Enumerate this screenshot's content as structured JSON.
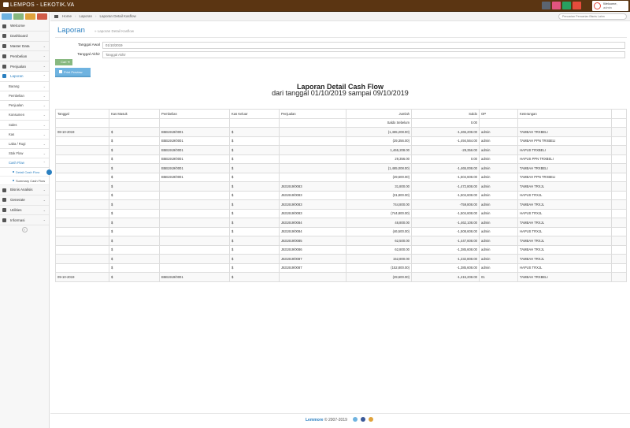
{
  "app": {
    "title": "LEMPOS - LEKOTIK.VA"
  },
  "topbar": {
    "icons": [
      {
        "name": "monitor-icon",
        "color": "#5b6470",
        "badge": ""
      },
      {
        "name": "user-icon",
        "color": "#e0547e",
        "badge": ""
      },
      {
        "name": "mail-icon",
        "color": "#27a060",
        "badge": ""
      },
      {
        "name": "cart-icon",
        "color": "#e74c3c",
        "badge": ""
      }
    ],
    "welcome": "Welcome,",
    "user": "admin"
  },
  "sidebar": {
    "shortcut_colors": [
      "#6fb3e0",
      "#87b87f",
      "#e0a33c",
      "#d15b47"
    ],
    "items": [
      {
        "label": "Welcome",
        "icon": "home-icon"
      },
      {
        "label": "Dashboard",
        "icon": "dashboard-icon"
      },
      {
        "label": "Master Data",
        "icon": "desktop-icon",
        "chevron": "⌄"
      },
      {
        "label": "Pembelian",
        "icon": "list-icon",
        "chevron": "⌄"
      },
      {
        "label": "Penjualan",
        "icon": "edit-icon",
        "chevron": "⌄"
      },
      {
        "label": "Laporan",
        "icon": "chart-icon",
        "chevron": "⌃"
      }
    ],
    "laporan_sub": [
      {
        "label": "Barang",
        "chevron": "⌄"
      },
      {
        "label": "Pembelian",
        "chevron": "⌄"
      },
      {
        "label": "Penjualan",
        "chevron": "⌄"
      },
      {
        "label": "Konsumen",
        "chevron": "⌄"
      },
      {
        "label": "Sales",
        "chevron": "⌄"
      },
      {
        "label": "Kas",
        "chevron": "⌄"
      },
      {
        "label": "Laba / Rugi",
        "chevron": "⌄"
      },
      {
        "label": "Stok Flow",
        "chevron": "⌄"
      },
      {
        "label": "Cash Flow",
        "chevron": "⌃"
      }
    ],
    "cashflow_sub": [
      "Detail Cash Flow",
      "Summary Cash Flow"
    ],
    "items_after": [
      {
        "label": "Bisnis Analisis",
        "icon": "trend-icon",
        "chevron": "⌄"
      },
      {
        "label": "Generate",
        "icon": "gears-icon",
        "chevron": "⌄"
      },
      {
        "label": "Utilities",
        "icon": "tool-icon",
        "chevron": "⌄"
      },
      {
        "label": "Informasi",
        "icon": "info-icon",
        "chevron": "⌄"
      }
    ],
    "collapse": "«"
  },
  "breadcrumb": {
    "home": "Home",
    "laporan": "Laporan",
    "current": "Laporan Detail Kasflow"
  },
  "search": {
    "placeholder": "Pencarian Pencarian Bisnis Lainn"
  },
  "header": {
    "title": "Laporan",
    "subtitle": "» Laporan Detail Kasflow"
  },
  "form": {
    "tanggal_awal_label": "Tanggal Awal",
    "tanggal_awal_value": "01/10/2019",
    "tanggal_akhir_label": "Tanggal Akhir",
    "tanggal_akhir_placeholder": "Tanggal Akhir",
    "cari_label": "Cari",
    "print_label": "Print Preview"
  },
  "report": {
    "title": "Laporan Detail Cash Flow",
    "subtitle": "dari tanggal 01/10/2019 sampai 09/10/2019",
    "columns": [
      "Tanggal",
      "Kas Masuk",
      "Pembelian",
      "Kas Keluar",
      "Penjualan",
      "Jumlah",
      "Saldo",
      "OP",
      "Keterangan",
      ""
    ],
    "saldo_sebelum_label": "Saldo Sebelum",
    "saldo_sebelum_value": "0.00",
    "rows": [
      [
        "08-10-2019",
        "$",
        "B5B1919/0001",
        "$",
        "",
        "(1,465,208.00)",
        "-1,465,208.00",
        "admin",
        "TAMBAH TRXBELI",
        ""
      ],
      [
        "",
        "$",
        "B5B1919/0001",
        "$",
        "",
        "(29,356.00)",
        "-1,494,564.00",
        "admin",
        "TAMBAH PPN TRXBELI",
        ""
      ],
      [
        "",
        "$",
        "B5B1919/0001",
        "$",
        "",
        "1,465,208.00",
        "-29,356.00",
        "admin",
        "HAPUS TRXBELI",
        ""
      ],
      [
        "",
        "$",
        "B5B1919/0001",
        "$",
        "",
        "29,356.00",
        "0.00",
        "admin",
        "HAPUS PPN TRXBELI",
        ""
      ],
      [
        "",
        "$",
        "B5B1919/0001",
        "$",
        "",
        "(1,465,008.00)",
        "-1,465,008.00",
        "admin",
        "TAMBAH TRXBELI",
        ""
      ],
      [
        "",
        "$",
        "B5B1919/0001",
        "$",
        "",
        "(29,600.00)",
        "-1,504,608.00",
        "admin",
        "TAMBAH PPN TRXBELI",
        ""
      ],
      [
        "",
        "$",
        "",
        "$",
        "J631919/0083",
        "31,800.00",
        "-1,472,808.00",
        "admin",
        "TAMBAH TRXJL",
        ""
      ],
      [
        "",
        "$",
        "",
        "$",
        "J631919/0083",
        "(31,800.00)",
        "-1,504,608.00",
        "admin",
        "HAPUS TRXJL",
        ""
      ],
      [
        "",
        "$",
        "",
        "$",
        "J631919/0083",
        "744,800.00",
        "-759,808.00",
        "admin",
        "TAMBAH TRXJL",
        ""
      ],
      [
        "",
        "$",
        "",
        "$",
        "J631919/0083",
        "(744,800.00)",
        "-1,504,608.00",
        "admin",
        "HAPUS TRXJL",
        ""
      ],
      [
        "",
        "$",
        "",
        "$",
        "J631919/0084",
        "46,800.00",
        "-1,462,108.00",
        "admin",
        "TAMBAH TRXJL",
        ""
      ],
      [
        "",
        "$",
        "",
        "$",
        "J631919/0084",
        "(46,500.00)",
        "-1,508,608.00",
        "admin",
        "HAPUS TRXJL",
        ""
      ],
      [
        "",
        "$",
        "",
        "$",
        "J631919/0085",
        "62,500.00",
        "-1,447,608.00",
        "admin",
        "TAMBAH TRXJL",
        ""
      ],
      [
        "",
        "$",
        "",
        "$",
        "J631919/0086",
        "62,800.00",
        "-1,385,608.00",
        "admin",
        "TAMBAH TRXJL",
        ""
      ],
      [
        "",
        "$",
        "",
        "$",
        "J631919/0087",
        "152,800.00",
        "-1,232,808.00",
        "admin",
        "TAMBAH TRXJL",
        ""
      ],
      [
        "",
        "$",
        "",
        "$",
        "J631919/0087",
        "(152,800.00)",
        "-1,385,608.00",
        "admin",
        "HAPUS TRXJL",
        ""
      ],
      [
        "09-10-2019",
        "$",
        "B5B1919/0001",
        "$",
        "",
        "(29,600.00)",
        "-1,415,208.00",
        "01",
        "TAMBAH TRXBELI",
        ""
      ]
    ]
  },
  "footer": {
    "brand": "Lemmore",
    "copy": "© 2007-2019"
  }
}
